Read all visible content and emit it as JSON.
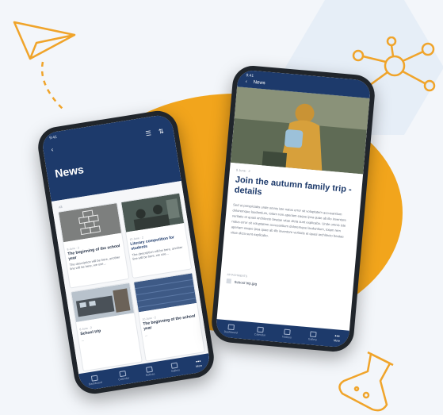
{
  "colors": {
    "brand": "#1d3a6b",
    "accent": "#f2a51c",
    "line": "#f0a42a"
  },
  "phone_left": {
    "time": "9:41",
    "header_title": "News",
    "section_label": "All",
    "cards": [
      {
        "meta": "8 June · 2",
        "title": "The beginning of the school year",
        "desc": "The description will be here, another line will be here, we use..."
      },
      {
        "meta": "10 June · 2",
        "title": "Literary competition for students",
        "desc": "The description will be here, another line will be here, we use..."
      },
      {
        "meta": "8 June · 2",
        "title": "School trip",
        "desc": "..."
      },
      {
        "meta": "10 June · 2",
        "title": "The beginning of the school year",
        "desc": "..."
      }
    ],
    "nav": [
      {
        "label": "Dashboard",
        "icon": "home-icon"
      },
      {
        "label": "Calendar",
        "icon": "calendar-icon"
      },
      {
        "label": "Notices",
        "icon": "mail-icon"
      },
      {
        "label": "Gallery",
        "icon": "image-icon"
      },
      {
        "label": "More",
        "icon": "more-icon"
      }
    ]
  },
  "phone_right": {
    "time": "9:41",
    "header_title": "News",
    "meta": "8 June · 2",
    "title": "Join the autumn family trip - details",
    "body": "Sed ut perspiciatis unde omnis iste natus error sit voluptatem accusantium doloremque laudantium, totam rem aperiam eaque ipsa quae ab illo inventore veritatis et quasi architecto beatae vitae dicta sunt explicabo. Unde omnis iste natus error sit voluptatem accusantium doloremque laudantium, totam rem aperiam eaque ipsa quae ab illo inventore veritatis et quasi architecto beatae vitae dicta sunt explicabo.",
    "attachments_label": "ATTACHMENTS",
    "attachment": "School trip.jpg",
    "nav": [
      {
        "label": "Dashboard",
        "icon": "home-icon"
      },
      {
        "label": "Calendar",
        "icon": "calendar-icon"
      },
      {
        "label": "Notices",
        "icon": "mail-icon"
      },
      {
        "label": "Gallery",
        "icon": "image-icon"
      },
      {
        "label": "More",
        "icon": "more-icon"
      }
    ]
  }
}
